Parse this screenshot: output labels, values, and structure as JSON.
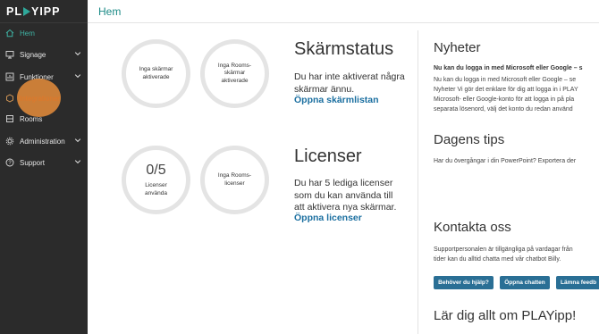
{
  "sidebar": {
    "logo_left": "PL",
    "logo_right": "YIPP",
    "items": [
      {
        "label": "Hem"
      },
      {
        "label": "Signage"
      },
      {
        "label": "Funktioner"
      },
      {
        "label": "Integrationer"
      },
      {
        "label": "Rooms"
      },
      {
        "label": "Administration"
      },
      {
        "label": "Support"
      }
    ]
  },
  "header": {
    "title": "Hem"
  },
  "screen_status": {
    "circle1": "Inga skärmar aktiverade",
    "circle2": "Inga Rooms-skärmar aktiverade",
    "title": "Skärmstatus",
    "text": "Du har inte aktiverat några skärmar ännu.",
    "link": "Öppna skärmlistan"
  },
  "licenses": {
    "count": "0/5",
    "count_label": "Licenser använda",
    "circle2": "Inga Rooms-licenser",
    "title": "Licenser",
    "text": "Du har 5 lediga licenser som du kan använda till att aktivera nya skärmar.",
    "link": "Öppna licenser"
  },
  "news": {
    "title": "Nyheter",
    "headline": "Nu kan du logga in med Microsoft eller Google – s",
    "lines": [
      "Nu kan du logga in med Microsoft eller Google – se",
      "Nyheter Vi gör det enklare för dig att logga in i PLAY",
      "Microsoft- eller Google-konto för att logga in på pla",
      "separata lösenord, välj det konto du redan använd"
    ]
  },
  "tips": {
    "title": "Dagens tips",
    "text": "Har du övergångar i din PowerPoint? Exportera der"
  },
  "contact": {
    "title": "Kontakta oss",
    "lines": [
      "Supportpersonalen är tillgängliga på vardagar från",
      "tider kan du alltid chatta med vår chatbot Billy."
    ],
    "btn_help": "Behöver du hjälp?",
    "btn_chat": "Öppna chatten",
    "btn_feedback": "Lämna feedb"
  },
  "learn": {
    "title": "Lär dig allt om PLAYipp!"
  },
  "colors": {
    "sidebar": "#2b2b2b",
    "accent": "#3fb3a4",
    "link": "#1b6fa0",
    "button": "#2a6f95",
    "cursor": "#ee913c"
  },
  "icons": [
    "home-icon",
    "signage-icon",
    "functions-icon",
    "integrations-icon",
    "rooms-icon",
    "administration-icon",
    "support-icon",
    "chevron-down-icon"
  ]
}
